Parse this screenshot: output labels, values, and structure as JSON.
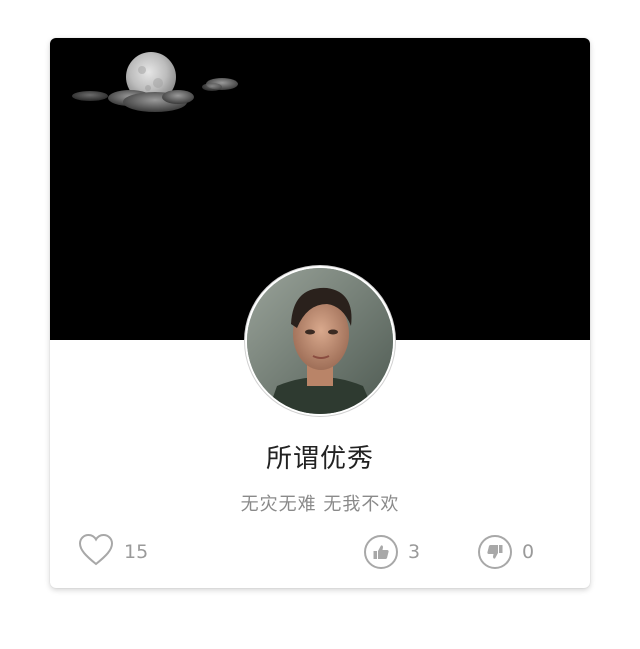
{
  "profile": {
    "name": "所谓优秀",
    "bio": "无灾无难 无我不欢"
  },
  "stats": {
    "likes": "15",
    "upvotes": "3",
    "downvotes": "0"
  },
  "icons": {
    "likes": "heart-icon",
    "upvotes": "thumbs-up-icon",
    "downvotes": "thumbs-down-icon"
  },
  "colors": {
    "cover_background": "#000000",
    "name_text": "#222222",
    "bio_text": "#8a8a8a",
    "icon_gray": "#a8a8a8"
  }
}
